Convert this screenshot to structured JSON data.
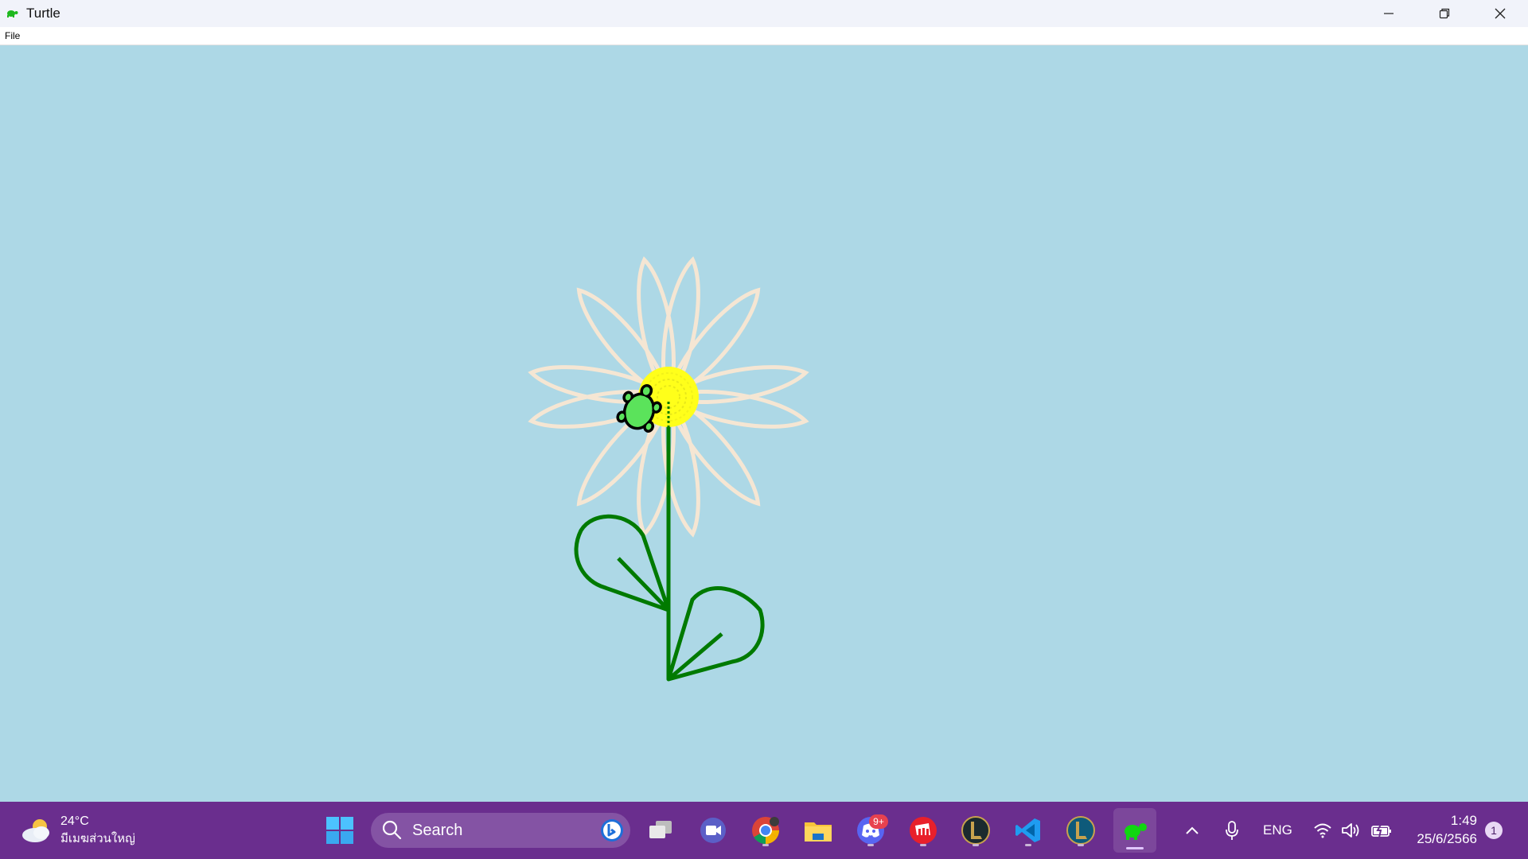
{
  "window": {
    "title": "Turtle",
    "menu": [
      "File"
    ]
  },
  "canvas": {
    "background": "#ADD8E6",
    "petal_color": "#F5E6D3",
    "center_color": "#FFFF1A",
    "stem_color": "#007A00",
    "turtle_color": "#5BE35B"
  },
  "taskbar": {
    "background": "#6A2E8E",
    "weather": {
      "temp": "24°C",
      "desc": "มีเมฆส่วนใหญ่"
    },
    "search": {
      "label": "Search"
    },
    "apps": [
      {
        "name": "task-view",
        "icon": "task-view-icon"
      },
      {
        "name": "meet",
        "icon": "meet-icon"
      },
      {
        "name": "chrome",
        "icon": "chrome-icon"
      },
      {
        "name": "file-explorer",
        "icon": "folder-icon"
      },
      {
        "name": "discord",
        "icon": "discord-icon",
        "badge": "9+"
      },
      {
        "name": "riot-client",
        "icon": "riot-icon"
      },
      {
        "name": "league-of-legends",
        "icon": "league-icon"
      },
      {
        "name": "vs-code",
        "icon": "vscode-icon"
      },
      {
        "name": "league-client",
        "icon": "league-client-icon"
      },
      {
        "name": "turtle",
        "icon": "turtle-icon"
      }
    ],
    "tray": {
      "language": "ENG",
      "time": "1:49",
      "date": "25/6/2566",
      "notifications": "1"
    }
  }
}
